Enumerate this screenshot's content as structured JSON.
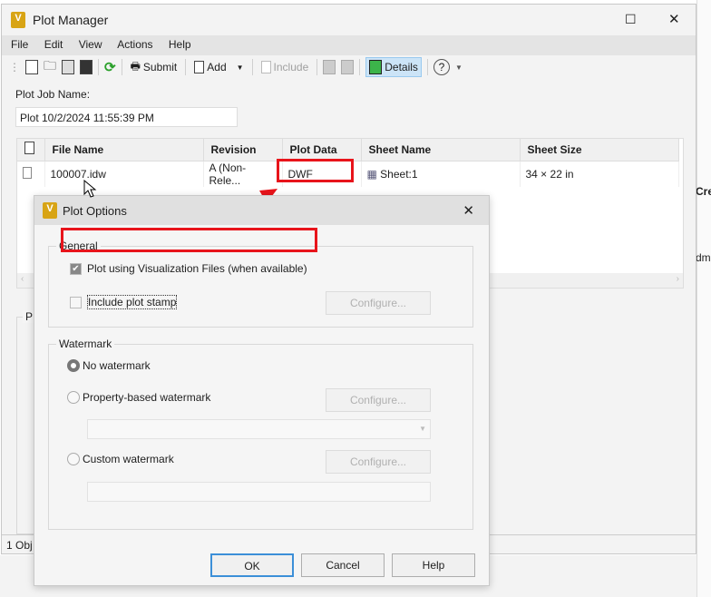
{
  "window": {
    "title": "Plot Manager",
    "close": "✕",
    "maximize": "☐",
    "minimize": "—"
  },
  "menu": [
    "File",
    "Edit",
    "View",
    "Actions",
    "Help"
  ],
  "toolbar": {
    "submit": "Submit",
    "add": "Add",
    "include": "Include",
    "details": "Details",
    "help": "?"
  },
  "job": {
    "label": "Plot Job Name:",
    "value": "Plot 10/2/2024 11:55:39 PM"
  },
  "table": {
    "headers": [
      "File Name",
      "Revision",
      "Plot Data",
      "Sheet Name",
      "Sheet Size"
    ],
    "rows": [
      {
        "file": "100007.idw",
        "revision": "A (Non-Rele...",
        "plot_data": "DWF",
        "sheet": "Sheet:1",
        "size": "34 × 22 in"
      }
    ]
  },
  "panel_letter": "P",
  "status": "1 Obj",
  "background": {
    "text1": "Crea",
    "text2": "dm"
  },
  "dialog": {
    "title": "Plot Options",
    "close": "✕",
    "general": {
      "legend": "General",
      "viz": "Plot using Visualization Files (when available)",
      "viz_checked": true,
      "stamp": "Include plot stamp",
      "stamp_checked": false,
      "configure": "Configure..."
    },
    "watermark": {
      "legend": "Watermark",
      "none": "No watermark",
      "property": "Property-based watermark",
      "custom": "Custom watermark",
      "configure": "Configure...",
      "selected": "none"
    },
    "ok": "OK",
    "cancel": "Cancel",
    "help": "Help"
  },
  "annotation_color": "#e8141b"
}
